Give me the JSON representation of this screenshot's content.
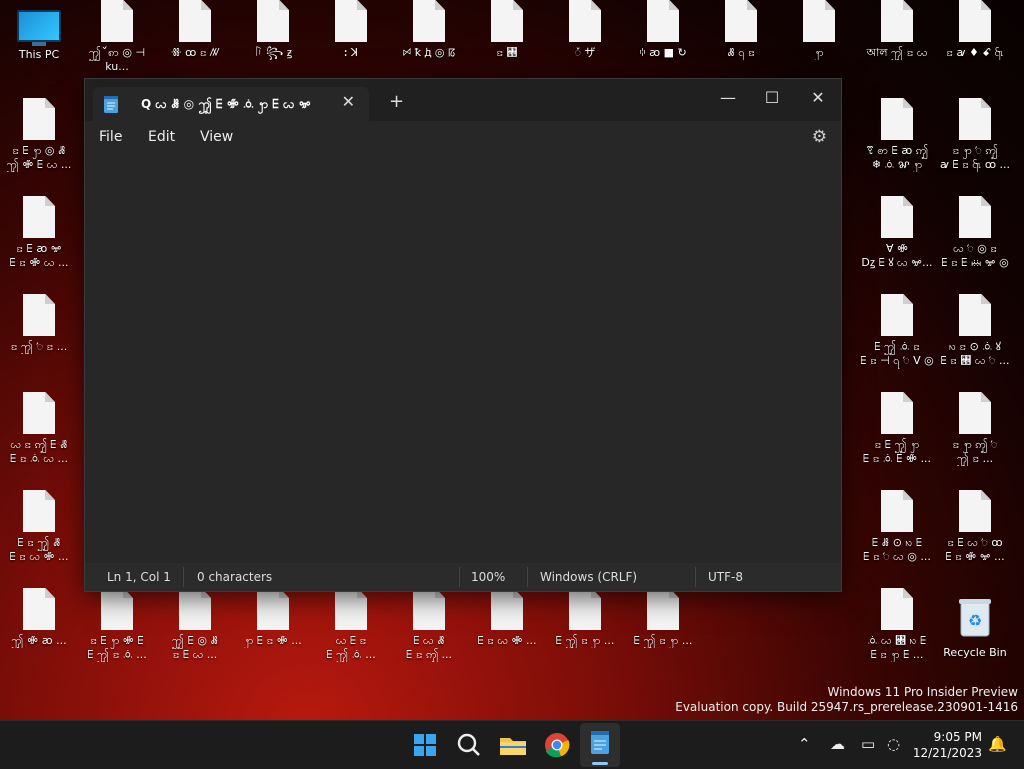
{
  "desktop": {
    "this_pc_label": "This PC",
    "recycle_bin_label": "Recycle Bin",
    "row1": [
      "ꩶ ꣺ ꩱ  ◎ ⊣ ku...",
      "ꗥ ꝏ ꤢ ꤲ",
      "ꑍ ꧂ ꙃ",
      "ꓽ ꓘ",
      "ꗯ ꝁ ꚁ ◎ ꡞ",
      "ꤢ ꥕",
      "ꥑ ザ",
      "ꗺ ꜵ ■ ↻",
      "ꗡ ꩹ ꤢ",
      "ꩭ",
      "আল ꩶ ꤢ ꩬ",
      "ꤢ ꜹ ♦ ꗃ ꩷"
    ],
    "row_labels_right": [
      "ꗦ ꩦ ꗋ ꜵ ꩵ\n❄ ꗝ ꨗ ꩭ",
      "ꤢ ꩭ ꥏ ꩵ\nꜹ ꗋ ꤢ ꩷ ꝏ ...",
      "ꓯ ꗂ\nDꙁ ꗋ ꙋ ꩬ ꗁ...",
      "ꩬ ꥏ ◎  ꤢ\n ꗋ ꤢ ꗋ ꗜ ꗁ ◎",
      "ꗋ ꩶ ꗝ ꤢ\nꗋ ꤢ ⊣ ꩹ ꥏ V ◎ ...",
      "ꩳ ꤢ ⊙ ꗝ ꙋ\nꗋ ꤢ ꥕ ꩬ ꥏ ...",
      "ꤢ ꗋ ꩶ ꩭ\nꗋ ꤢ ꗝ ꗋ ꗂ ...",
      "ꤢ ꩭ ꩵ ꥏ\n ꩶ ꤢ ... ",
      "ꗋ ꗡ ⊙ ꩳ ꗋ\nꗋ ꤢ ꥏ ꩬ ◎ ...",
      "ꤢ ꗋ ꩬ ꥏ ꝏ\nꗋ ꤢ ꗂ ꗁ ...",
      "ꗝ ꩬ ꥕ ꩳ ꗋ\nꗋ ꤢ ꩭ ꗋ ...",
      "ꗋ ꗡ ꗋ ꤢ ꥏ\nꗋ ꤢ ◎ ꙋ ..."
    ],
    "row_labels_left": [
      "ꤢ ꗋ ꩭ ◎ ꗡ\nꩶ ꗂ ꗋ ꩬ ...",
      "ꤢ ꗋ ꜵ ꗁ\nꗋ ꤢ ꗂ ꩬ ...",
      "ꤢ ꩶ ꥏ ꤢ ...",
      "ꩬ ꤢ ꩵ ꗋ ꗡ\nꗋ ꤢ ꗝ ꩬ ...",
      "ꗋ ꤢ ꩶ ꗡ\nꗋ ꤢ ꩬ ꗂ ..."
    ],
    "bottom_row": [
      "ꩶ ꗂ ꜵ ...",
      "ꤢ ꗋ ꩭ ꗂ ꗋ\nꗋ ꩶ ꤢ ꗝ ...",
      "ꩶ ꗋ ◎ ꗡ\nꤢ ꗋ ꩬ ...",
      "ꩭ ꗋ ꤢ ꗂ ...",
      "ꩬ ꗋ ꤢ\nꗋ ꩶ ꗝ ...",
      "ꗋ ꩬ ꗡ\nꗋ ꤢ ꩵ ...",
      "ꗋ ꤢ ꩬ ꗂ ...",
      "ꗋ ꩶ ꤢ ꩭ ..."
    ]
  },
  "notepad": {
    "tab_title": "Q ꩬ ꗡ ◎ ꩶ ꗋ ꗂ ꗝ ꩭ ꗋ ꩬ ꗁ",
    "menu": {
      "file": "File",
      "edit": "Edit",
      "view": "View"
    },
    "status": {
      "position": "Ln 1, Col 1",
      "characters": "0 characters",
      "zoom": "100%",
      "line_ending": "Windows (CRLF)",
      "encoding": "UTF-8"
    }
  },
  "watermark": {
    "line1": "Windows 11 Pro Insider Preview",
    "line2": "Evaluation copy. Build 25947.rs_prerelease.230901-1416"
  },
  "taskbar": {
    "time": "9:05 PM",
    "date": "12/21/2023"
  },
  "colors": {
    "accent": "#0a84ff",
    "window_bg": "#272727",
    "taskbar_bg": "#1c1c1c"
  }
}
